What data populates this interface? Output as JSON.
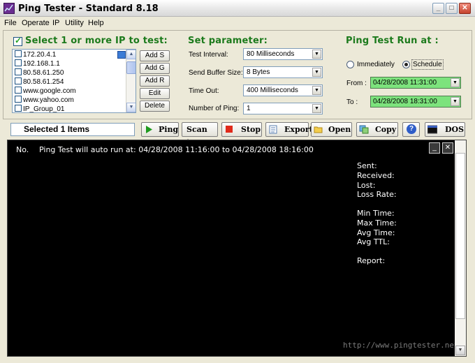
{
  "window": {
    "title": "Ping Tester - Standard  8.18",
    "buttons": {
      "minimize": "_",
      "maximize": "□",
      "close": "✕"
    }
  },
  "menu": [
    "File",
    "Operate",
    "IP",
    "Utility",
    "Help"
  ],
  "ip_section": {
    "title": "Select 1 or more IP to test:",
    "select_all_checked": true,
    "items": [
      {
        "label": "172.20.4.1",
        "checked": false,
        "selected": true
      },
      {
        "label": "192.168.1.1",
        "checked": false
      },
      {
        "label": "80.58.61.250",
        "checked": false
      },
      {
        "label": "80.58.61.254",
        "checked": false
      },
      {
        "label": "www.google.com",
        "checked": false
      },
      {
        "label": "www.yahoo.com",
        "checked": false
      },
      {
        "label": "IP_Group_01",
        "checked": false
      }
    ],
    "buttons": {
      "add_s": "Add S",
      "add_g": "Add G",
      "add_r": "Add R",
      "edit": "Edit",
      "delete": "Delete"
    }
  },
  "params": {
    "title": "Set parameter:",
    "test_interval": {
      "label": "Test Interval:",
      "value": "80  Milliseconds"
    },
    "send_buffer": {
      "label": "Send Buffer Size:",
      "value": "8  Bytes"
    },
    "time_out": {
      "label": "Time Out:",
      "value": "400  Milliseconds"
    },
    "number_of_ping": {
      "label": "Number of Ping:",
      "value": "1"
    }
  },
  "schedule": {
    "title": "Ping Test Run at :",
    "immediately": "Immediately",
    "schedule": "Schedule",
    "selected": "schedule",
    "from_label": "From :",
    "from_value": "04/28/2008 11:31:00",
    "to_label": "To :",
    "to_value": "04/28/2008 18:31:00"
  },
  "toolbar": {
    "selection_text": "Selected 1 Items",
    "ping": "Ping",
    "scan_ip": "Scan ip",
    "stop": "Stop",
    "export": "Export",
    "open": "Open",
    "copy": "Copy",
    "help": "?",
    "dos": "DOS"
  },
  "console": {
    "header_no": "No.",
    "header_msg": "Ping Test will auto run at:  04/28/2008 11:16:00  to  04/28/2008 18:16:00",
    "stats": {
      "sent": "Sent:",
      "received": "Received:",
      "lost": "Lost:",
      "loss_rate": "Loss Rate:",
      "min_time": "Min Time:",
      "max_time": "Max Time:",
      "avg_time": "Avg Time:",
      "avg_ttl": "Avg TTL:",
      "report": "Report:"
    },
    "url": "http://www.pingtester.net",
    "btn_min": "_",
    "btn_close": "✕"
  },
  "colors": {
    "section_title": "#1c7a1c",
    "date_field_bg": "#7de37d",
    "console_bg": "#000000"
  }
}
